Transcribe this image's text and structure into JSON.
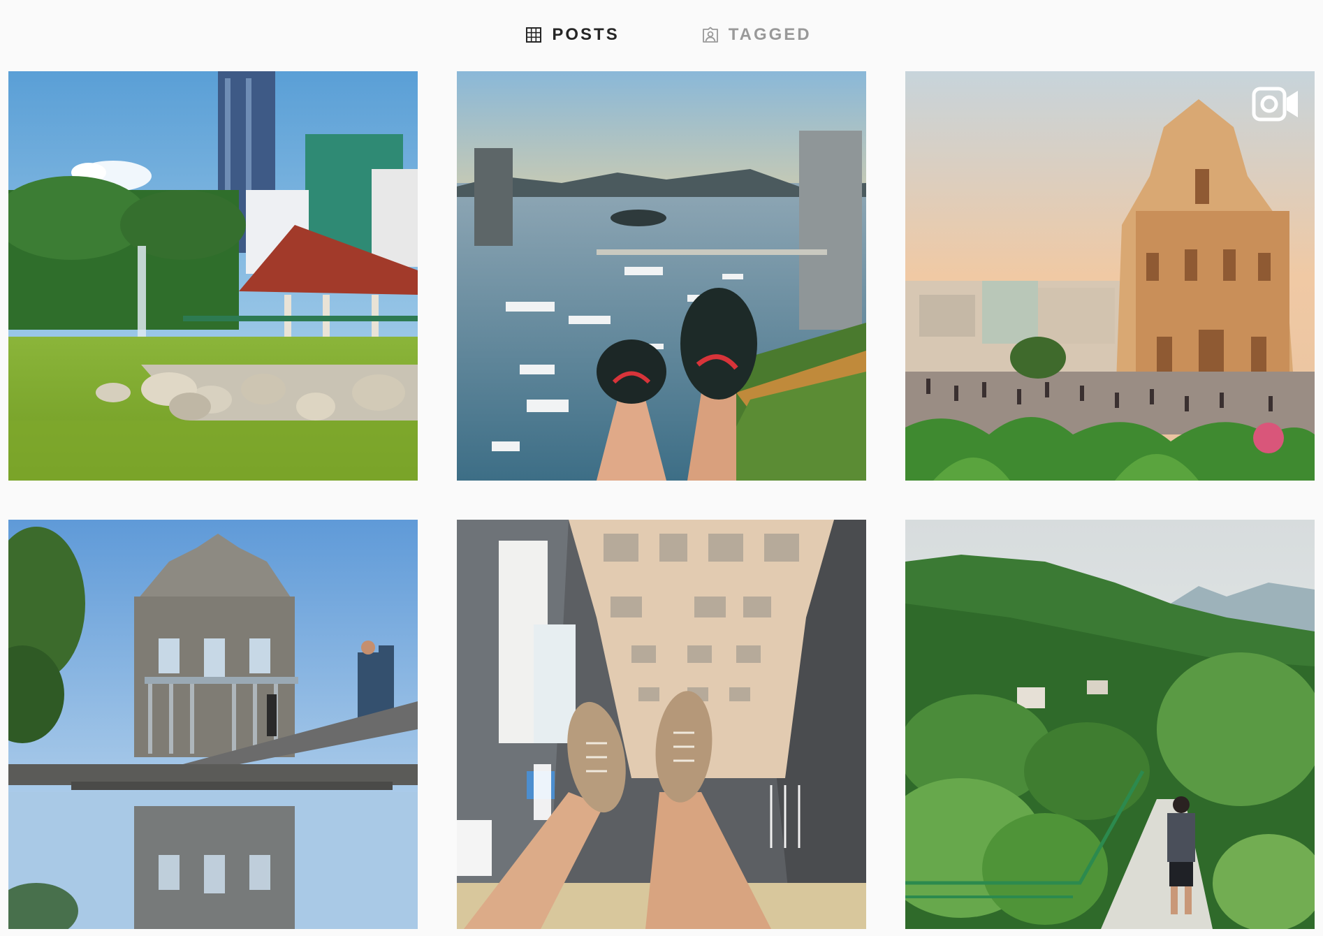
{
  "tabs": [
    {
      "label": "POSTS",
      "icon": "grid-icon",
      "active": true
    },
    {
      "label": "TAGGED",
      "icon": "tagged-person-icon",
      "active": false
    }
  ],
  "posts": [
    {
      "scene": "garden-pond-pavilion-skyscrapers",
      "type": "photo"
    },
    {
      "scene": "harbour-sunset-sneakers-overlook",
      "type": "photo"
    },
    {
      "scene": "ruins-of-st-paul-sunset-crowd",
      "type": "video",
      "overlay_icon": "video-camera-icon"
    },
    {
      "scene": "ruins-of-st-paul-reflection-pool",
      "type": "photo"
    },
    {
      "scene": "rooftop-dangling-feet-over-alley",
      "type": "photo"
    },
    {
      "scene": "green-hills-trail-hiker",
      "type": "photo"
    }
  ],
  "colors": {
    "background": "#fafafa",
    "active_tab": "#262626",
    "inactive_tab": "#999999"
  }
}
